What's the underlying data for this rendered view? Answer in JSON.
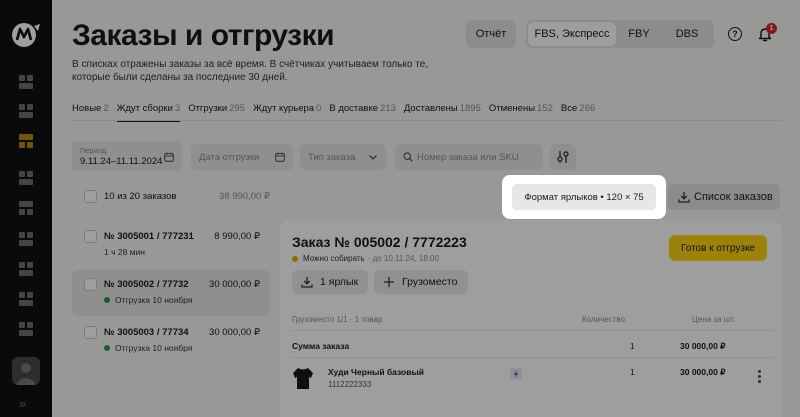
{
  "header": {
    "title": "Заказы и отгрузки",
    "subtitle": "В списках отражены заказы за всё время. В счётчиках учитываем только те, которые были сделаны за последние 30 дней.",
    "report_label": "Отчёт",
    "modes": [
      "FBS, Экспресс",
      "FBY",
      "DBS"
    ],
    "notification_count": "1"
  },
  "tabs": [
    {
      "label": "Новые",
      "count": "2"
    },
    {
      "label": "Ждут сборки",
      "count": "3"
    },
    {
      "label": "Отгрузки",
      "count": "295"
    },
    {
      "label": "Ждут курьера",
      "count": "0"
    },
    {
      "label": "В доставке",
      "count": "213"
    },
    {
      "label": "Доставлены",
      "count": "1895"
    },
    {
      "label": "Отменены",
      "count": "152"
    },
    {
      "label": "Все",
      "count": "266"
    }
  ],
  "filters": {
    "period_label": "Период",
    "period_value": "9.11.24–11.11.2024",
    "date_placeholder": "Дата отгрузки",
    "type_placeholder": "Тип заказа",
    "search_placeholder": "Номер заказа или SKU"
  },
  "list": {
    "select_all_label": "10 из 20 заказов",
    "select_all_sum": "38 990,00 ₽",
    "orders": [
      {
        "number": "№ 3005001 / 777231",
        "sum": "8 990,00 ₽",
        "sub": "1 ч 28 мин"
      },
      {
        "number": "№ 3005002 / 77732",
        "sum": "30 000,00 ₽",
        "sub": "Отгрузка 10 ноября"
      },
      {
        "number": "№ 3005003 / 77734",
        "sum": "30 000,00 ₽",
        "sub": "Отгрузка 10 ноября"
      }
    ]
  },
  "actions": {
    "label_format": "Формат ярлыков • 120 × 75",
    "orders_list": "Список заказов"
  },
  "detail": {
    "title": "Заказ № 005002 / 7772223",
    "status": "Можно собирать",
    "status_note": "· до 10.11.24, 18:00",
    "ready_button": "Готов к отгрузке",
    "labels_button": "1 ярлык",
    "place_button": "Грузоместо",
    "col_place": "Грузоместо 1/1 · 1 товар",
    "col_qty": "Количество",
    "col_price": "Цена за шт.",
    "sum_label": "Сумма заказа",
    "sum_qty": "1",
    "sum_price": "30 000,00 ₽",
    "product_name": "Худи Черный базовый",
    "product_sku": "1112222333",
    "product_qty": "1",
    "product_price": "30 000,00 ₽"
  },
  "colors": {
    "accent_yellow": "#fcd213",
    "status_green": "#1c9b48",
    "badge_red": "#e3262b"
  }
}
